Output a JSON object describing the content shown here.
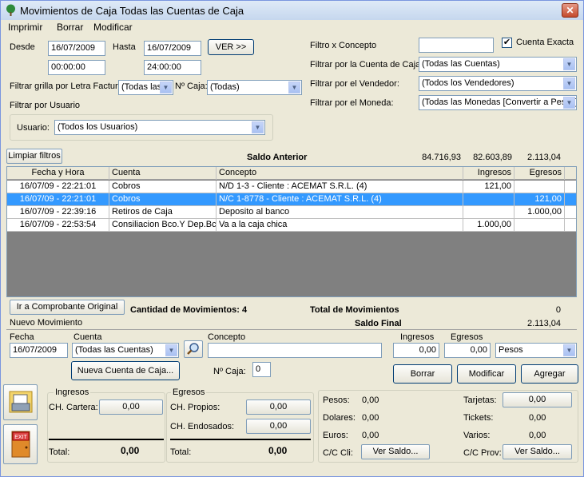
{
  "window": {
    "title": "Movimientos de Caja Todas las Cuentas de Caja",
    "close": "✕"
  },
  "menu": [
    "Imprimir",
    "Borrar",
    "Modificar"
  ],
  "filters": {
    "desde_label": "Desde",
    "desde_date": "16/07/2009",
    "desde_time": "00:00:00",
    "hasta_label": "Hasta",
    "hasta_date": "16/07/2009",
    "hasta_time": "24:00:00",
    "ver_button": "VER >>",
    "letra_label": "Filtrar grilla por Letra Factura:",
    "letra_value": "(Todas las",
    "caja_label": "Nº Caja:",
    "caja_value": "(Todas)",
    "usuario_section": "Filtrar por Usuario",
    "usuario_label": "Usuario:",
    "usuario_value": "(Todos los Usuarios)",
    "concepto_label": "Filtro x Concepto",
    "concepto_value": "",
    "cuenta_exacta_label": "Cuenta Exacta",
    "cuenta_exacta_checked": true,
    "cuenta_caja_label": "Filtrar por la Cuenta de Caja:",
    "cuenta_caja_value": "(Todas las Cuentas)",
    "vendedor_label": "Filtrar por el Vendedor:",
    "vendedor_value": "(Todos los Vendedores)",
    "moneda_label": "Filtrar por el Moneda:",
    "moneda_value": "(Todas las Monedas [Convertir a Pesos]"
  },
  "summary": {
    "limpiar_button": "Limpiar filtros",
    "saldo_anterior_label": "Saldo Anterior",
    "saldo_anterior_values": [
      "84.716,93",
      "82.603,89",
      "2.113,04"
    ]
  },
  "grid": {
    "columns": [
      "Fecha y Hora",
      "Cuenta",
      "Concepto",
      "Ingresos",
      "Egresos"
    ],
    "rows": [
      [
        "16/07/09 - 22:21:01",
        "Cobros",
        "N/D 1-3 - Cliente : ACEMAT S.R.L. (4)",
        "121,00",
        ""
      ],
      [
        "16/07/09 - 22:21:01",
        "Cobros",
        "N/C 1-8778 - Cliente : ACEMAT S.R.L. (4)",
        "",
        "121,00"
      ],
      [
        "16/07/09 - 22:39:16",
        "Retiros de Caja",
        "Deposito al banco",
        "",
        "1.000,00"
      ],
      [
        "16/07/09 - 22:53:54",
        "Consiliacion Bco.Y Dep.Bc",
        "Va a la caja chica",
        "1.000,00",
        ""
      ]
    ],
    "selected_row": 1
  },
  "totals": {
    "ir_button": "Ir a Comprobante Original",
    "cantidad_label": "Cantidad de Movimientos: 4",
    "total_mov_label": "Total de Movimientos",
    "total_mov_value": "0",
    "saldo_final_label": "Saldo Final",
    "saldo_final_value": "2.113,04"
  },
  "nuevo": {
    "section": "Nuevo Movimiento",
    "fecha_label": "Fecha",
    "fecha_value": "16/07/2009",
    "cuenta_label": "Cuenta",
    "cuenta_value": "(Todas las Cuentas)",
    "concepto_label": "Concepto",
    "concepto_value": "",
    "ingresos_label": "Ingresos",
    "ingresos_value": "0,00",
    "egresos_label": "Egresos",
    "egresos_value": "0,00",
    "moneda_value": "Pesos",
    "nueva_cuenta_button": "Nueva Cuenta de Caja...",
    "nro_caja_label": "Nº Caja:",
    "nro_caja_value": "0",
    "borrar_button": "Borrar",
    "modificar_button": "Modificar",
    "agregar_button": "Agregar"
  },
  "bottom": {
    "ingresos_title": "Ingresos",
    "ch_cartera_label": "CH. Cartera:",
    "ch_cartera_value": "0,00",
    "ingresos_total_label": "Total:",
    "ingresos_total_value": "0,00",
    "egresos_title": "Egresos",
    "ch_propios_label": "CH. Propios:",
    "ch_propios_value": "0,00",
    "ch_endosados_label": "CH. Endosados:",
    "ch_endosados_value": "0,00",
    "egresos_total_label": "Total:",
    "egresos_total_value": "0,00",
    "pesos_label": "Pesos:",
    "pesos_value": "0,00",
    "dolares_label": "Dolares:",
    "dolares_value": "0,00",
    "euros_label": "Euros:",
    "euros_value": "0,00",
    "cc_cli_label": "C/C Cli:",
    "cc_cli_button": "Ver Saldo...",
    "tarjetas_label": "Tarjetas:",
    "tarjetas_value": "0,00",
    "tickets_label": "Tickets:",
    "tickets_value": "0,00",
    "varios_label": "Varios:",
    "varios_value": "0,00",
    "cc_prov_label": "C/C Prov:",
    "cc_prov_button": "Ver Saldo...",
    "exit_text": "EXIT"
  }
}
